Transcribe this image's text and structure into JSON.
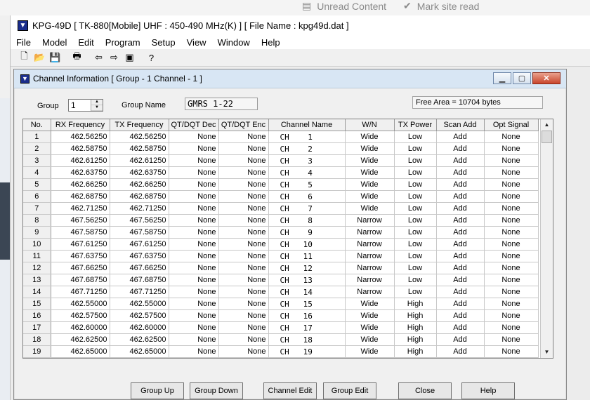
{
  "background": {
    "unread_label": "Unread Content",
    "mark_read_label": "Mark site read"
  },
  "app": {
    "title": "KPG-49D  [ TK-880[Mobile] UHF : 450-490 MHz(K) ] [ File Name : kpg49d.dat ]",
    "menu": [
      "File",
      "Model",
      "Edit",
      "Program",
      "Setup",
      "View",
      "Window",
      "Help"
    ]
  },
  "dialog": {
    "title": "Channel Information [ Group - 1   Channel - 1 ]",
    "group_label": "Group",
    "group_value": "1",
    "group_name_label": "Group Name",
    "group_name_value": "GMRS 1-22",
    "free_area": "Free Area = 10704 bytes",
    "columns": [
      "No.",
      "RX Frequency",
      "TX Frequency",
      "QT/DQT Dec",
      "QT/DQT Enc",
      "Channel Name",
      "W/N",
      "TX Power",
      "Scan Add",
      "Opt Signal"
    ],
    "rows": [
      [
        "1",
        "462.56250",
        "462.56250",
        "None",
        "None",
        "CH    1",
        "Wide",
        "Low",
        "Add",
        "None"
      ],
      [
        "2",
        "462.58750",
        "462.58750",
        "None",
        "None",
        "CH    2",
        "Wide",
        "Low",
        "Add",
        "None"
      ],
      [
        "3",
        "462.61250",
        "462.61250",
        "None",
        "None",
        "CH    3",
        "Wide",
        "Low",
        "Add",
        "None"
      ],
      [
        "4",
        "462.63750",
        "462.63750",
        "None",
        "None",
        "CH    4",
        "Wide",
        "Low",
        "Add",
        "None"
      ],
      [
        "5",
        "462.66250",
        "462.66250",
        "None",
        "None",
        "CH    5",
        "Wide",
        "Low",
        "Add",
        "None"
      ],
      [
        "6",
        "462.68750",
        "462.68750",
        "None",
        "None",
        "CH    6",
        "Wide",
        "Low",
        "Add",
        "None"
      ],
      [
        "7",
        "462.71250",
        "462.71250",
        "None",
        "None",
        "CH    7",
        "Wide",
        "Low",
        "Add",
        "None"
      ],
      [
        "8",
        "467.56250",
        "467.56250",
        "None",
        "None",
        "CH    8",
        "Narrow",
        "Low",
        "Add",
        "None"
      ],
      [
        "9",
        "467.58750",
        "467.58750",
        "None",
        "None",
        "CH    9",
        "Narrow",
        "Low",
        "Add",
        "None"
      ],
      [
        "10",
        "467.61250",
        "467.61250",
        "None",
        "None",
        "CH   10",
        "Narrow",
        "Low",
        "Add",
        "None"
      ],
      [
        "11",
        "467.63750",
        "467.63750",
        "None",
        "None",
        "CH   11",
        "Narrow",
        "Low",
        "Add",
        "None"
      ],
      [
        "12",
        "467.66250",
        "467.66250",
        "None",
        "None",
        "CH   12",
        "Narrow",
        "Low",
        "Add",
        "None"
      ],
      [
        "13",
        "467.68750",
        "467.68750",
        "None",
        "None",
        "CH   13",
        "Narrow",
        "Low",
        "Add",
        "None"
      ],
      [
        "14",
        "467.71250",
        "467.71250",
        "None",
        "None",
        "CH   14",
        "Narrow",
        "Low",
        "Add",
        "None"
      ],
      [
        "15",
        "462.55000",
        "462.55000",
        "None",
        "None",
        "CH   15",
        "Wide",
        "High",
        "Add",
        "None"
      ],
      [
        "16",
        "462.57500",
        "462.57500",
        "None",
        "None",
        "CH   16",
        "Wide",
        "High",
        "Add",
        "None"
      ],
      [
        "17",
        "462.60000",
        "462.60000",
        "None",
        "None",
        "CH   17",
        "Wide",
        "High",
        "Add",
        "None"
      ],
      [
        "18",
        "462.62500",
        "462.62500",
        "None",
        "None",
        "CH   18",
        "Wide",
        "High",
        "Add",
        "None"
      ],
      [
        "19",
        "462.65000",
        "462.65000",
        "None",
        "None",
        "CH   19",
        "Wide",
        "High",
        "Add",
        "None"
      ]
    ],
    "buttons": {
      "group_up": "Group Up",
      "group_down": "Group Down",
      "channel_edit": "Channel Edit",
      "group_edit": "Group Edit",
      "close": "Close",
      "help": "Help"
    }
  }
}
